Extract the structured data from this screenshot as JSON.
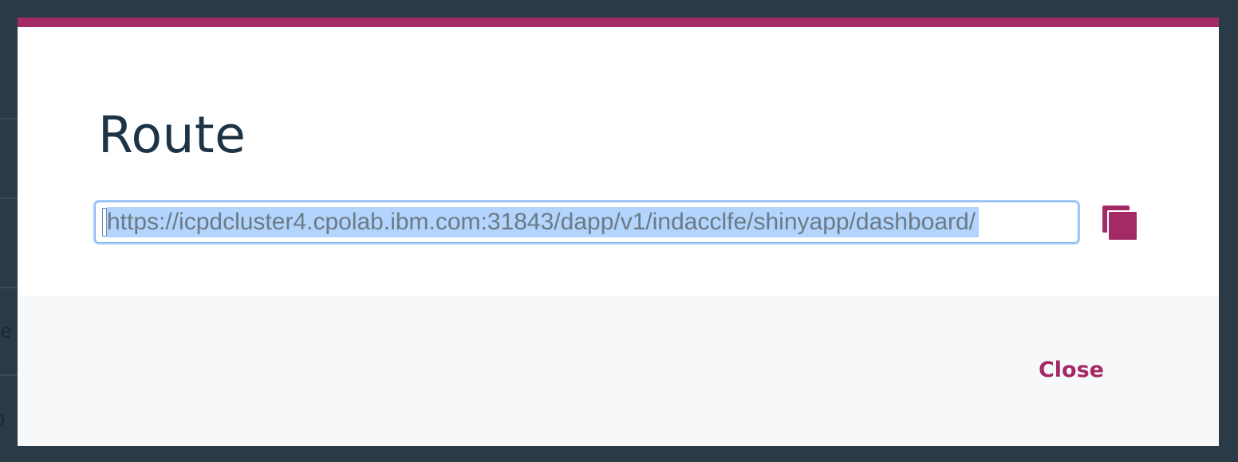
{
  "background": {
    "fragment_1": "be",
    "fragment_2": "io"
  },
  "modal": {
    "title": "Route",
    "route_url": "https://icpdcluster4.cpolab.ibm.com:31843/dapp/v1/indacclfe/shinyapp/dashboard/",
    "copy_icon": "copy-icon",
    "close_label": "Close"
  },
  "colors": {
    "accent": "#a32a65",
    "overlay": "#2a3a47",
    "title_text": "#1d3447",
    "selection": "#b3d4fc",
    "footer_bg": "#f7f8fa"
  }
}
